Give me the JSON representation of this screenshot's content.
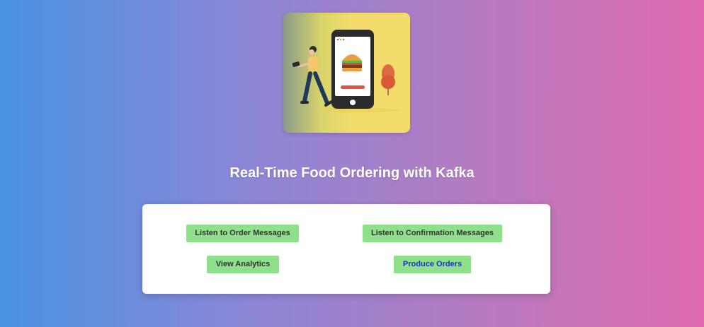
{
  "page": {
    "title": "Real-Time Food Ordering with Kafka"
  },
  "buttons": {
    "listen_orders": "Listen to Order Messages",
    "listen_confirmations": "Listen to Confirmation Messages",
    "view_analytics": "View Analytics",
    "produce_orders": "Produce Orders"
  },
  "colors": {
    "button_bg": "#8fe08a",
    "produce_text": "#1a2fd1",
    "gradient_left": "#4a92e2",
    "gradient_right": "#e06bb0"
  }
}
